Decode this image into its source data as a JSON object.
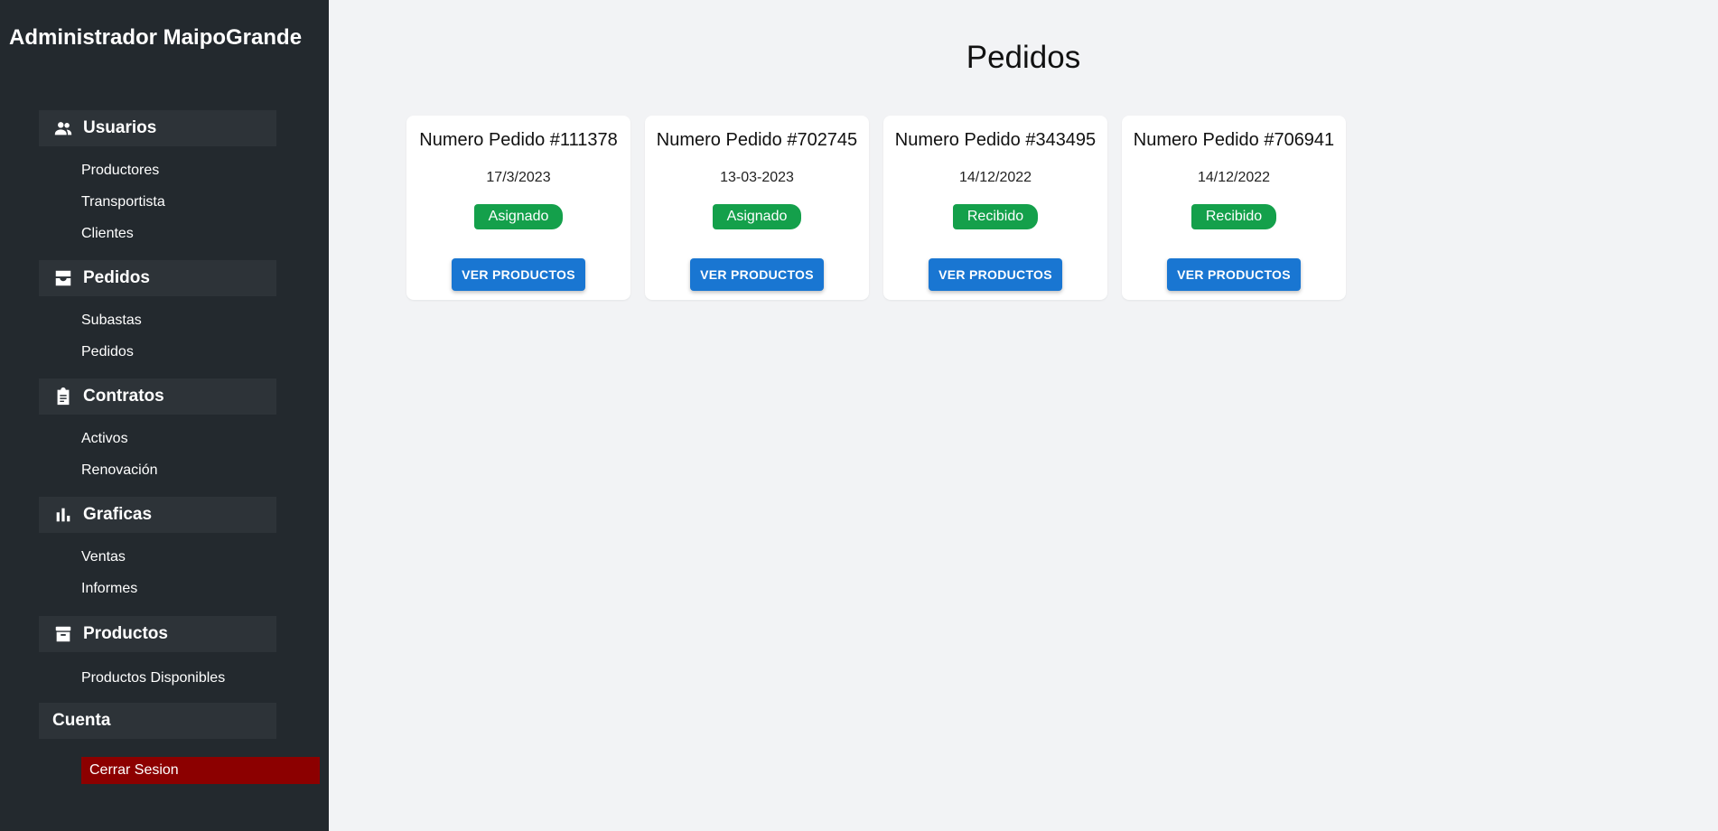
{
  "sidebar": {
    "title": "Administrador MaipoGrande",
    "sections": [
      {
        "label": "Usuarios",
        "icon": "users-icon",
        "items": [
          "Productores",
          "Transportista",
          "Clientes"
        ]
      },
      {
        "label": "Pedidos",
        "icon": "inbox-icon",
        "items": [
          "Subastas",
          "Pedidos"
        ]
      },
      {
        "label": "Contratos",
        "icon": "clipboard-icon",
        "items": [
          "Activos",
          "Renovación"
        ]
      },
      {
        "label": "Graficas",
        "icon": "bar-chart-icon",
        "items": [
          "Ventas",
          "Informes"
        ]
      },
      {
        "label": "Productos",
        "icon": "archive-icon",
        "items": [
          "Productos Disponibles"
        ]
      }
    ],
    "account": {
      "label": "Cuenta",
      "logout_label": "Cerrar Sesion"
    }
  },
  "main": {
    "title": "Pedidos",
    "orders": [
      {
        "title": "Numero Pedido #111378",
        "date": "17/3/2023",
        "status": "Asignado",
        "button": "VER PRODUCTOS"
      },
      {
        "title": "Numero Pedido #702745",
        "date": "13-03-2023",
        "status": "Asignado",
        "button": "VER PRODUCTOS"
      },
      {
        "title": "Numero Pedido #343495",
        "date": "14/12/2022",
        "status": "Recibido",
        "button": "VER PRODUCTOS"
      },
      {
        "title": "Numero Pedido #706941",
        "date": "14/12/2022",
        "status": "Recibido",
        "button": "VER PRODUCTOS"
      }
    ]
  },
  "colors": {
    "sidebar_bg": "#23292e",
    "section_bg": "#2d3338",
    "status_green": "#14a04b",
    "button_blue": "#1976d2",
    "logout_red": "#8c0000"
  }
}
